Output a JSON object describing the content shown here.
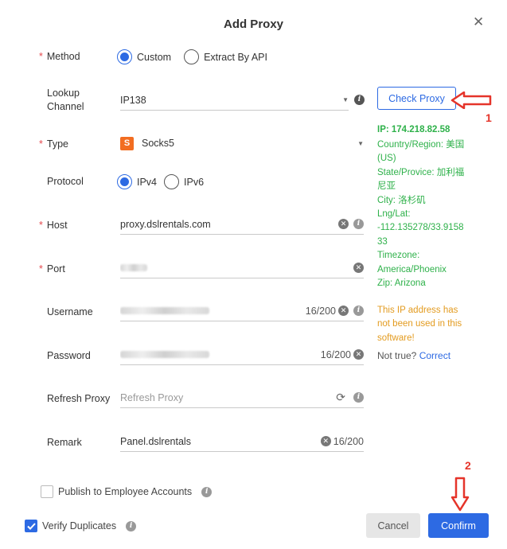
{
  "dialog": {
    "title": "Add Proxy"
  },
  "form": {
    "method": {
      "label": "Method",
      "options": [
        "Custom",
        "Extract By API"
      ],
      "selected": "Custom"
    },
    "lookup_channel": {
      "label_line1": "Lookup",
      "label_line2": "Channel",
      "value": "IP138"
    },
    "type": {
      "label": "Type",
      "value": "Socks5",
      "icon_letter": "S"
    },
    "protocol": {
      "label": "Protocol",
      "options": [
        "IPv4",
        "IPv6"
      ],
      "selected": "IPv4"
    },
    "host": {
      "label": "Host",
      "value": "proxy.dslrentals.com"
    },
    "port": {
      "label": "Port"
    },
    "username": {
      "label": "Username",
      "count": "16/200"
    },
    "password": {
      "label": "Password",
      "count": "16/200"
    },
    "refresh_proxy": {
      "label": "Refresh Proxy",
      "placeholder": "Refresh Proxy"
    },
    "remark": {
      "label": "Remark",
      "value": "Panel.dslrentals",
      "count": "16/200"
    },
    "publish": {
      "label": "Publish to Employee Accounts",
      "checked": false
    },
    "verify": {
      "label": "Verify Duplicates",
      "checked": true
    }
  },
  "check_proxy": {
    "button_label": "Check Proxy",
    "ip": "IP:  174.218.82.58",
    "country_l1": "Country/Region: 美国",
    "country_l2": "(US)",
    "state_l1": "State/Provice: 加利福",
    "state_l2": "尼亚",
    "city": "City: 洛杉矶",
    "lnglat_l1": "Lng/Lat:",
    "lnglat_l2": "-112.135278/33.9158",
    "lnglat_l3": "33",
    "timezone_l1": "Timezone:",
    "timezone_l2": "America/Phoenix",
    "zip": "Zip: Arizona",
    "notice_l1": "This IP address has",
    "notice_l2": "not been used in this",
    "notice_l3": "software!",
    "not_true": "Not true?",
    "correct": "Correct"
  },
  "annotations": {
    "label1": "1",
    "label2": "2",
    "arrow_color": "#e5342a"
  },
  "footer": {
    "cancel": "Cancel",
    "confirm": "Confirm"
  },
  "colors": {
    "primary": "#2d6ae3",
    "success": "#2eb14a",
    "warning": "#e39b1f",
    "required": "#e5484d",
    "socks_badge": "#f26d21"
  }
}
